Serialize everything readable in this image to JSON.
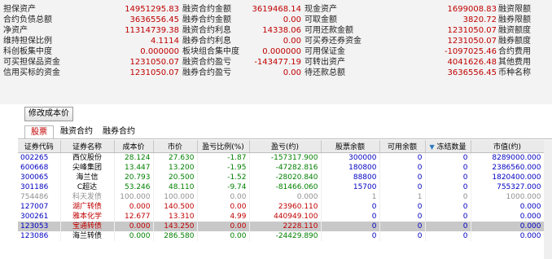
{
  "summary": [
    {
      "l1": "担保资产",
      "v1": "14951295.83",
      "l2": "融资合约金额",
      "v2": "3619468.14",
      "l3": "现金资产",
      "v3": "1699008.83",
      "l4": "融资限额"
    },
    {
      "l1": "合约负债总额",
      "v1": "3636556.45",
      "l2": "融券合约金额",
      "v2": "0.00",
      "l3": "可取金额",
      "v3": "3820.72",
      "l4": "融券限额"
    },
    {
      "l1": "净资产",
      "v1": "11314739.38",
      "l2": "融资合约利息",
      "v2": "14338.06",
      "l3": "可用还款金额",
      "v3": "1231050.07",
      "l4": "融资额度"
    },
    {
      "l1": "维持担保比例",
      "v1": "4.1114",
      "l2": "融券合约利息",
      "v2": "0.00",
      "l3": "可买券还券资金",
      "v3": "1231050.07",
      "l4": "融券额度"
    },
    {
      "l1": "科创板集中度",
      "v1": "0.000000",
      "l2": "板块组合集中度",
      "v2": "0.000000",
      "l3": "可用保证金",
      "v3": "-1097025.46",
      "l4": "合约费用"
    },
    {
      "l1": "可买担保品资金",
      "v1": "1231050.07",
      "l2": "融资合约盈亏",
      "v2": "-143477.19",
      "l3": "可转出资产",
      "v3": "4041626.48",
      "l4": "其他费用"
    },
    {
      "l1": "信用买标的资金",
      "v1": "1231050.07",
      "l2": "融券合约盈亏",
      "v2": "0.00",
      "l3": "待还款总额",
      "v3": "3636556.45",
      "l4": "币种名称"
    }
  ],
  "modify_cost_button": "修改成本价",
  "tabs": [
    "股票",
    "融资合约",
    "融券合约"
  ],
  "columns": [
    "证券代码",
    "证券名称",
    "成本价",
    "市价",
    "盈亏比例(%)",
    "盈亏(约)",
    "股票余额",
    "可用余额",
    "冻结数量",
    "市值(约)"
  ],
  "rows": [
    {
      "code": "002265",
      "name": "西仪股份",
      "cost": "28.124",
      "price": "27.630",
      "pct": "-1.87",
      "pl": "-157317.900",
      "bal": "300000",
      "avail": "0",
      "frozen": "0",
      "mv": "8289000.000",
      "tone": "green"
    },
    {
      "code": "600668",
      "name": "尖峰集团",
      "cost": "13.447",
      "price": "13.200",
      "pct": "-1.95",
      "pl": "-47282.816",
      "bal": "180800",
      "avail": "0",
      "frozen": "0",
      "mv": "2386560.000",
      "tone": "green"
    },
    {
      "code": "300065",
      "name": "海兰信",
      "cost": "20.793",
      "price": "20.500",
      "pct": "-1.52",
      "pl": "-28020.840",
      "bal": "88800",
      "avail": "0",
      "frozen": "0",
      "mv": "1820400.000",
      "tone": "green"
    },
    {
      "code": "301186",
      "name": "C超达",
      "cost": "53.246",
      "price": "48.110",
      "pct": "-9.74",
      "pl": "-81466.060",
      "bal": "15700",
      "avail": "0",
      "frozen": "0",
      "mv": "755327.000",
      "tone": "green"
    },
    {
      "code": "754486",
      "name": "科天发债",
      "cost": "100.000",
      "price": "100.000",
      "pct": "0.00",
      "pl": "0.000",
      "bal": "1",
      "avail": "1",
      "frozen": "0",
      "mv": "1000.000",
      "tone": "gray"
    },
    {
      "code": "127007",
      "name": "湖广转债",
      "cost": "0.000",
      "price": "140.500",
      "pct": "0.00",
      "pl": "23960.110",
      "bal": "0",
      "avail": "0",
      "frozen": "0",
      "mv": "0.000",
      "tone": "red"
    },
    {
      "code": "300261",
      "name": "雅本化学",
      "cost": "12.677",
      "price": "13.310",
      "pct": "4.99",
      "pl": "440949.100",
      "bal": "0",
      "avail": "0",
      "frozen": "0",
      "mv": "0.000",
      "tone": "red"
    },
    {
      "code": "123053",
      "name": "宝通转债",
      "cost": "0.000",
      "price": "143.250",
      "pct": "0.00",
      "pl": "2228.110",
      "bal": "0",
      "avail": "0",
      "frozen": "0",
      "mv": "0.000",
      "tone": "red",
      "highlight": true
    },
    {
      "code": "123086",
      "name": "海兰转债",
      "cost": "0.000",
      "price": "286.580",
      "pct": "0.00",
      "pl": "-24429.890",
      "bal": "0",
      "avail": "0",
      "frozen": "0",
      "mv": "0.000",
      "tone": "green"
    }
  ],
  "colors": {
    "accent": "#c00000",
    "positive": "#c00000",
    "negative": "#008000",
    "code": "#0000c0",
    "header_bg": "#eaeaea",
    "highlight_row": "#c8c8c8"
  },
  "icons": {
    "sort": "sort-down-icon"
  }
}
